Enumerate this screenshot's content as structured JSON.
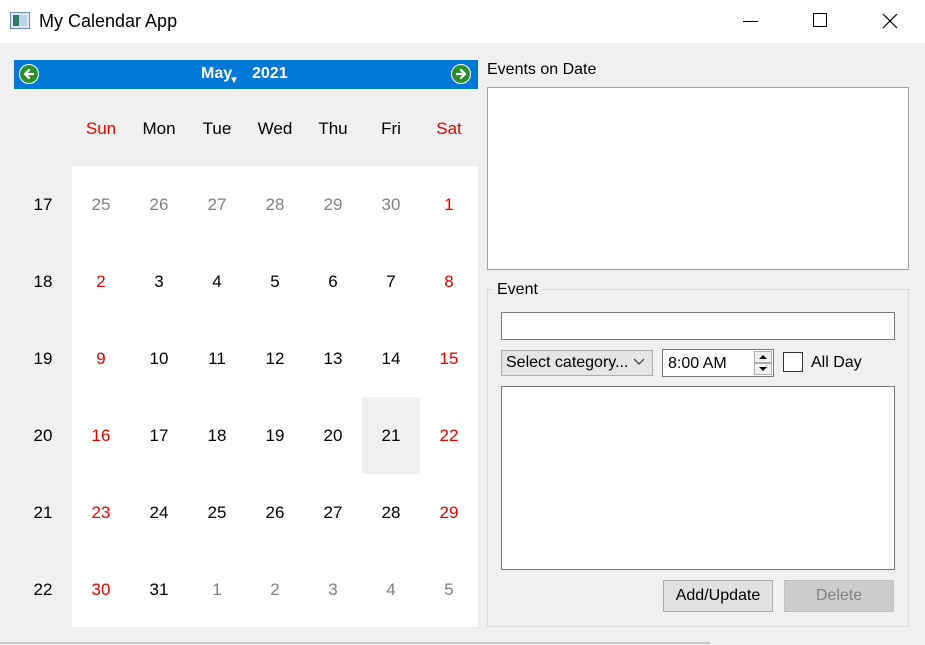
{
  "window": {
    "title": "My Calendar App"
  },
  "calendar": {
    "month": "May",
    "year": "2021",
    "weekdays": [
      "Sun",
      "Mon",
      "Tue",
      "Wed",
      "Thu",
      "Fri",
      "Sat"
    ],
    "week_numbers": [
      "17",
      "18",
      "19",
      "20",
      "21",
      "22"
    ],
    "weeks": [
      [
        "25",
        "26",
        "27",
        "28",
        "29",
        "30",
        "1"
      ],
      [
        "2",
        "3",
        "4",
        "5",
        "6",
        "7",
        "8"
      ],
      [
        "9",
        "10",
        "11",
        "12",
        "13",
        "14",
        "15"
      ],
      [
        "16",
        "17",
        "18",
        "19",
        "20",
        "21",
        "22"
      ],
      [
        "23",
        "24",
        "25",
        "26",
        "27",
        "28",
        "29"
      ],
      [
        "30",
        "31",
        "1",
        "2",
        "3",
        "4",
        "5"
      ]
    ],
    "selected_date": "21"
  },
  "events_panel": {
    "label": "Events on Date"
  },
  "event_form": {
    "group_title": "Event",
    "title_value": "",
    "category_value": "Select category...",
    "time_value": "8:00 AM",
    "all_day_label": "All Day",
    "all_day_checked": false,
    "add_label": "Add/Update",
    "delete_label": "Delete"
  },
  "colors": {
    "header_blue": "#0078d7",
    "weekend_red": "#e60000",
    "other_month_gray": "#808080",
    "nav_green": "#2d8f2d"
  }
}
